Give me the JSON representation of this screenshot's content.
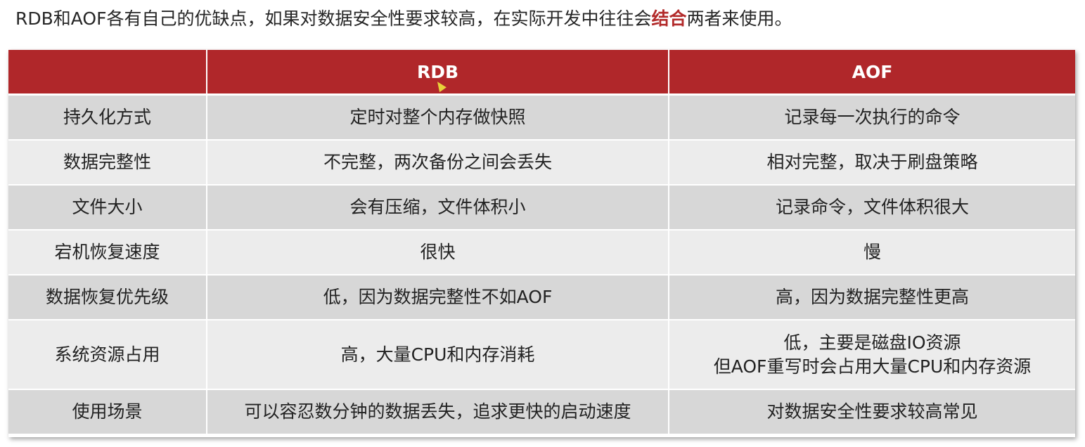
{
  "intro": {
    "before": "RDB和AOF各有自己的优缺点，如果对数据安全性要求较高，在实际开发中往往会",
    "highlight": "结合",
    "after": "两者来使用。"
  },
  "table": {
    "headers": [
      "",
      "RDB",
      "AOF"
    ],
    "rows": [
      {
        "label": "持久化方式",
        "rdb": "定时对整个内存做快照",
        "aof": "记录每一次执行的命令"
      },
      {
        "label": "数据完整性",
        "rdb": "不完整，两次备份之间会丢失",
        "aof": "相对完整，取决于刷盘策略"
      },
      {
        "label": "文件大小",
        "rdb": "会有压缩，文件体积小",
        "aof": "记录命令，文件体积很大"
      },
      {
        "label": "宕机恢复速度",
        "rdb": "很快",
        "aof": "慢"
      },
      {
        "label": "数据恢复优先级",
        "rdb": "低，因为数据完整性不如AOF",
        "aof": "高，因为数据完整性更高"
      },
      {
        "label": "系统资源占用",
        "rdb": "高，大量CPU和内存消耗",
        "aof_line1": "低，主要是磁盘IO资源",
        "aof_line2": "但AOF重写时会占用大量CPU和内存资源"
      },
      {
        "label": "使用场景",
        "rdb": "可以容忍数分钟的数据丢失，追求更快的启动速度",
        "aof": "对数据安全性要求较高常见"
      }
    ]
  },
  "colors": {
    "header_bg": "#b0272a",
    "highlight_text": "#b22a2a",
    "row_dark": "#d7d7d7",
    "row_light": "#ececec"
  },
  "icons": {
    "cursor": "mouse-pointer-icon"
  }
}
